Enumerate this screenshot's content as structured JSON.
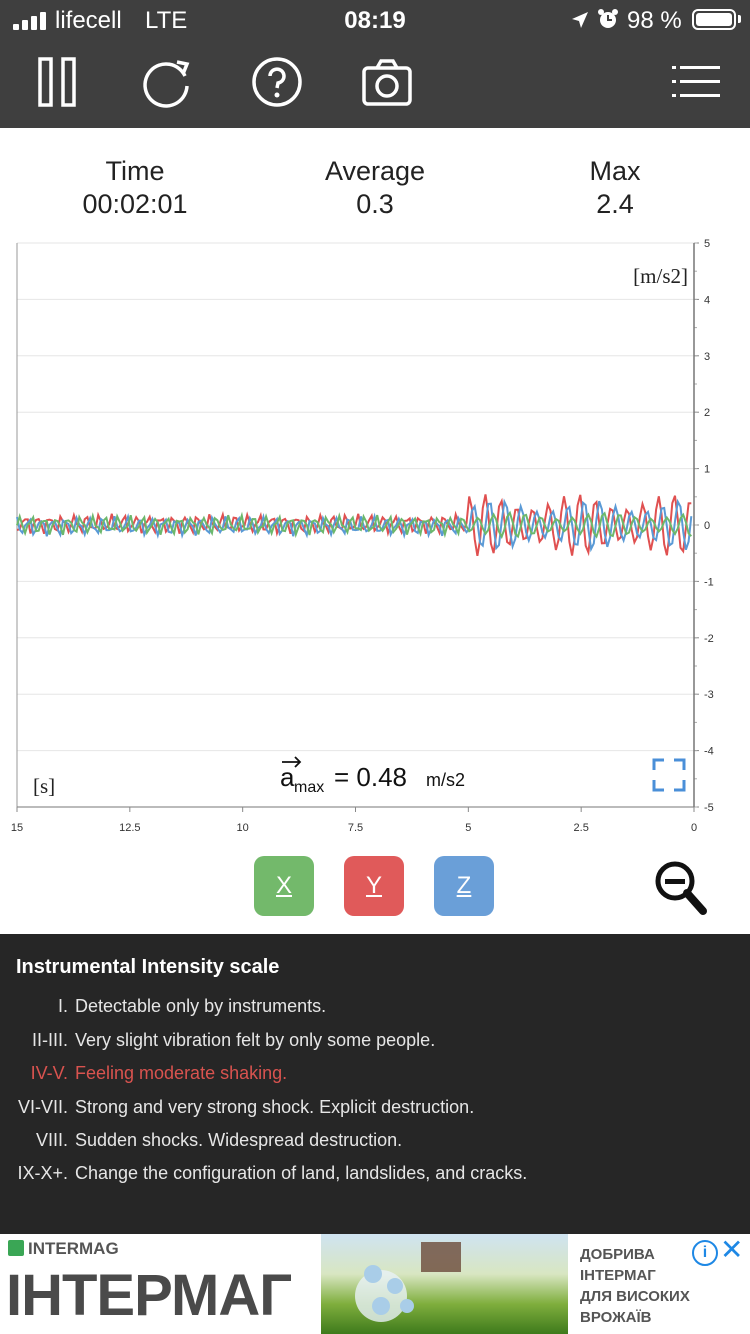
{
  "status_bar": {
    "carrier": "lifecell",
    "network": "LTE",
    "time": "08:19",
    "battery": "98 %"
  },
  "toolbar": {
    "icons": [
      "pause-icon",
      "refresh-icon",
      "help-icon",
      "camera-icon",
      "menu-icon"
    ]
  },
  "stats": {
    "time_label": "Time",
    "time_value": "00:02:01",
    "average_label": "Average",
    "average_value": "0.3",
    "max_label": "Max",
    "max_value": "2.4"
  },
  "chart_data": {
    "type": "line",
    "ylabel": "[m/s2]",
    "xlabel": "[s]",
    "xlim": [
      15,
      0
    ],
    "ylim": [
      -5,
      5
    ],
    "x_ticks": [
      "15",
      "12.5",
      "10",
      "7.5",
      "5",
      "2.5",
      "0"
    ],
    "y_ticks": [
      "5",
      "4",
      "3",
      "2",
      "1",
      "0",
      "-1",
      "-2",
      "-3",
      "-4",
      "-5"
    ],
    "annotation": {
      "symbol": "a",
      "subscript": "max",
      "equals": "= 0.48",
      "unit": "m/s2"
    },
    "series": [
      {
        "color": "#e05050",
        "description": "small noise near 0 from 15 to 5 s, then oscillation up to about ±0.6"
      },
      {
        "color": "#5a9ad6",
        "description": "small noise near 0 from 15 to 5 s, then oscillation up to about ±0.5"
      },
      {
        "color": "#6cb86c",
        "description": "small noise near 0 from 15 to 5 s, then oscillation up to about ±0.3"
      }
    ]
  },
  "axis_buttons": {
    "x": "X",
    "y": "Y",
    "z": "Z",
    "colors": {
      "x": "#73b96b",
      "y": "#e05a5a",
      "z": "#6a9fd8"
    }
  },
  "scale": {
    "title": "Instrumental Intensity scale",
    "rows": [
      {
        "num": "I.",
        "text": "Detectable only by instruments."
      },
      {
        "num": "II-III.",
        "text": "Very slight vibration felt by only some people."
      },
      {
        "num": "IV-V.",
        "text": "Feeling moderate shaking."
      },
      {
        "num": "VI-VII.",
        "text": "Strong and very strong shock. Explicit destruction."
      },
      {
        "num": "VIII.",
        "text": "Sudden shocks. Widespread destruction."
      },
      {
        "num": "IX-X+.",
        "text": "Change the configuration of land, landslides, and cracks."
      }
    ],
    "highlight_color": "#d9534f"
  },
  "ad": {
    "brand_small": "INTERMAG",
    "brand_big": "ІНТЕРМАГ",
    "slogan_line1": "ДОБРИВА",
    "slogan_line2": "ІНТЕРМАГ",
    "slogan_line3": "ДЛЯ ВИСОКИХ",
    "slogan_line4": "ВРОЖАЇВ"
  }
}
